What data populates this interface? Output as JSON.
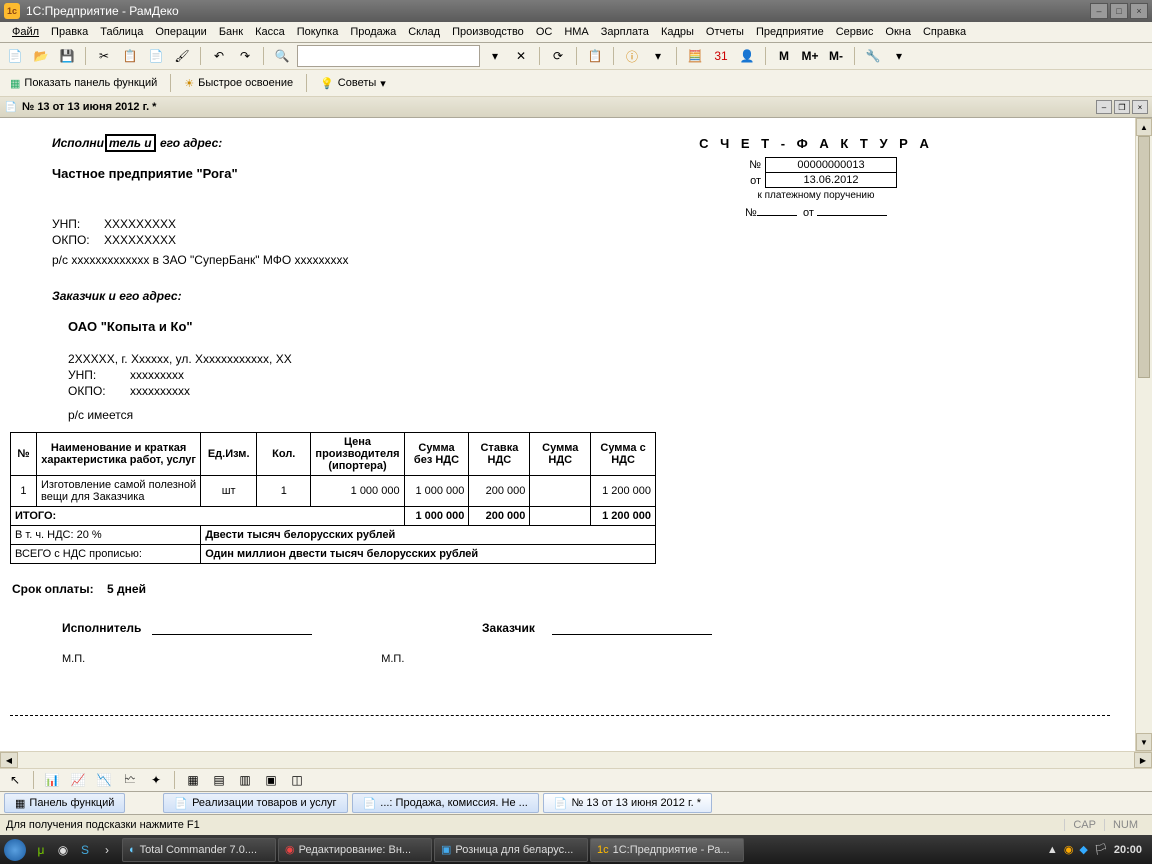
{
  "app": {
    "title": "1С:Предприятие - РамДеко"
  },
  "menu": [
    "Файл",
    "Правка",
    "Таблица",
    "Операции",
    "Банк",
    "Касса",
    "Покупка",
    "Продажа",
    "Склад",
    "Производство",
    "ОС",
    "НМА",
    "Зарплата",
    "Кадры",
    "Отчеты",
    "Предприятие",
    "Сервис",
    "Окна",
    "Справка"
  ],
  "toolbar2": {
    "panel_funcs": "Показать панель функций",
    "quick_learn": "Быстрое освоение",
    "tips": "Советы"
  },
  "toolbar_M": [
    "M",
    "M+",
    "M-"
  ],
  "doc": {
    "tab_title": "№ 13 от 13 июня 2012 г. *",
    "performer_label_pre": "Исполни",
    "performer_label_sel": "тель и",
    "performer_label_post": " его адрес:",
    "performer_name": "Частное предприятие \"Рога\"",
    "unp_label": "УНП:",
    "unp_value": "XXXXXXXXX",
    "okpo_label": "ОКПО:",
    "okpo_value": "XXXXXXXXX",
    "bank_line": "р/с xxxxxxxxxxxxx в ЗАО \"СуперБанк\"  МФО xxxxxxxxx",
    "customer_label": "Заказчик и его адрес:",
    "customer_name": "ОАО \"Копыта и Ко\"",
    "customer_addr": "2XXXXX, г. Xxxxxx, ул. Xxxxxxxxxxxx, XX",
    "customer_unp": "xxxxxxxxx",
    "customer_okpo": "xxxxxxxxxx",
    "customer_bank": "р/с имеется",
    "invoice_title": "С Ч Е Т - Ф А К Т У Р А",
    "num_label": "№",
    "num_value": "00000000013",
    "date_label": "от",
    "date_value": "13.06.2012",
    "pay_order_note": "к платежному поручению",
    "pay_num_label": "№",
    "pay_from_label": "от",
    "term_label": "Срок оплаты:",
    "term_value": "5 дней",
    "sig_performer": "Исполнитель",
    "sig_customer": "Заказчик",
    "mp": "М.П."
  },
  "table": {
    "headers": [
      "№",
      "Наименование и краткая характеристика работ, услуг",
      "Ед.Изм.",
      "Кол.",
      "Цена производителя (ипортера)",
      "Сумма без НДС",
      "Ставка НДС",
      "Сумма НДС",
      "Сумма с НДС"
    ],
    "rows": [
      {
        "n": "1",
        "name": "Изготовление самой полезной вещи для Заказчика",
        "unit": "шт",
        "qty": "1",
        "price": "1 000 000",
        "sum_no_vat": "1 000 000",
        "vat_rate": "200 000",
        "vat_sum": "",
        "sum_vat": "1 200 000"
      }
    ],
    "totals_label": "ИТОГО:",
    "totals": {
      "sum_no_vat": "1 000 000",
      "vat_rate": "200 000",
      "vat_sum": "",
      "sum_vat": "1 200 000"
    },
    "vat_row_label": "В т. ч.  НДС: 20 %",
    "vat_row_text": "Двести тысяч белорусских рублей",
    "total_words_label": "ВСЕГО с НДС прописью:",
    "total_words_text": "Один миллион двести тысяч белорусских рублей"
  },
  "wintabs": {
    "panel": "Панель функций",
    "tab1": "Реализации товаров и услуг",
    "tab2": "...: Продажа, комиссия. Не ...",
    "tab3": "№ 13 от 13 июня 2012 г. *"
  },
  "status": {
    "hint": "Для получения подсказки нажмите F1",
    "cap": "CAP",
    "num": "NUM"
  },
  "taskbar": {
    "tasks": [
      "Total Commander 7.0....",
      "Редактирование: Вн...",
      "Розница для беларус...",
      "1С:Предприятие - Ра..."
    ],
    "clock": "20:00"
  }
}
